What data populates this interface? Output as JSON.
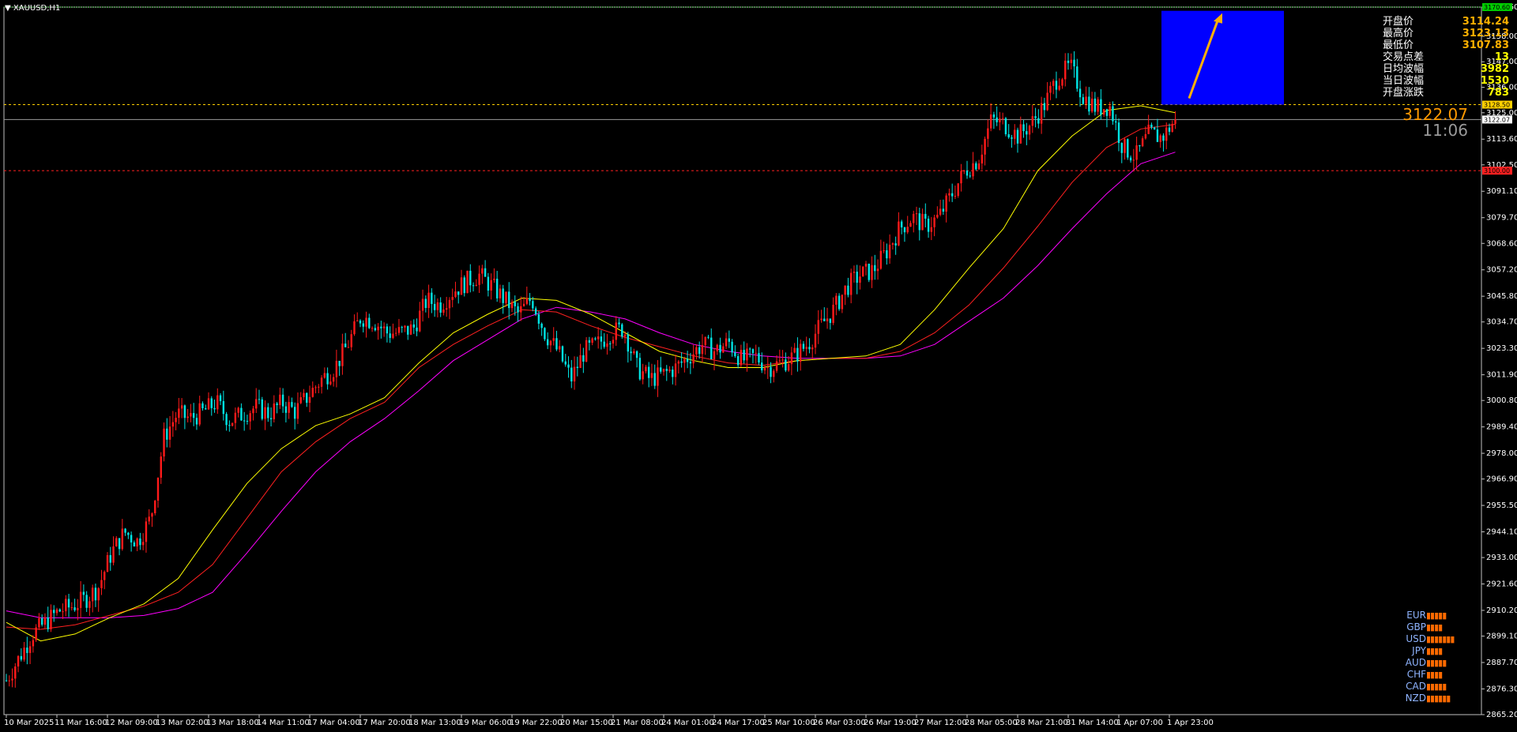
{
  "symbol": "XAUUSD,H1",
  "big_price": "3122.07",
  "countdown": "11:06",
  "stats": [
    {
      "label": "开盘价",
      "value": "3114.24"
    },
    {
      "label": "最高价",
      "value": "3123.13"
    },
    {
      "label": "最低价",
      "value": "3107.83"
    },
    {
      "label": "交易点差",
      "value": "13"
    },
    {
      "label": "日均波幅",
      "value": "3982"
    },
    {
      "label": "当日波幅",
      "value": "1530"
    },
    {
      "label": "开盘涨跌",
      "value": "783"
    }
  ],
  "currency_strength": [
    {
      "name": "EUR",
      "bars": "▮▮▮▮▮"
    },
    {
      "name": "GBP",
      "bars": "▮▮▮▮"
    },
    {
      "name": "USD",
      "bars": "▮▮▮▮▮▮▮"
    },
    {
      "name": "JPY",
      "bars": "▮▮▮▮"
    },
    {
      "name": "AUD",
      "bars": "▮▮▮▮▮"
    },
    {
      "name": "CHF",
      "bars": "▮▮▮▮"
    },
    {
      "name": "CAD",
      "bars": "▮▮▮▮▮"
    },
    {
      "name": "NZD",
      "bars": "▮▮▮▮▮▮"
    }
  ],
  "colors": {
    "background": "#000000",
    "bull": "#ff1a1a",
    "bear": "#00e5e5",
    "ma_fast": "#ffff00",
    "ma_mid": "#ff2020",
    "ma_slow": "#ff00ff",
    "target_box": "#0000ff",
    "arrow": "#ffb000"
  },
  "chart_data": {
    "type": "candlestick",
    "ylim": [
      2865.2,
      3170.6
    ],
    "y_ticks": [
      "3170.60",
      "3158.00",
      "3147.00",
      "3136.00",
      "3125.00",
      "3113.60",
      "3102.50",
      "3091.10",
      "3079.70",
      "3068.60",
      "3057.20",
      "3045.80",
      "3034.70",
      "3023.30",
      "3011.90",
      "3000.80",
      "2989.40",
      "2978.00",
      "2966.90",
      "2955.50",
      "2944.10",
      "2933.00",
      "2921.60",
      "2910.20",
      "2899.10",
      "2887.70",
      "2876.30",
      "2865.20"
    ],
    "x_labels": [
      "10 Mar 2025",
      "11 Mar 16:00",
      "12 Mar 09:00",
      "13 Mar 02:00",
      "13 Mar 18:00",
      "14 Mar 11:00",
      "17 Mar 04:00",
      "17 Mar 20:00",
      "18 Mar 13:00",
      "19 Mar 06:00",
      "19 Mar 22:00",
      "20 Mar 15:00",
      "21 Mar 08:00",
      "24 Mar 01:00",
      "24 Mar 17:00",
      "25 Mar 10:00",
      "26 Mar 03:00",
      "26 Mar 19:00",
      "27 Mar 12:00",
      "28 Mar 05:00",
      "28 Mar 21:00",
      "31 Mar 14:00",
      "1 Apr 07:00",
      "1 Apr 23:00"
    ],
    "bars_per_label": 17,
    "anchors": [
      2880,
      2890,
      2900,
      2905,
      2910,
      2912,
      2915,
      2920,
      2935,
      2944,
      2940,
      2950,
      2985,
      2995,
      2993,
      2996,
      3000,
      2992,
      2995,
      2998,
      2995,
      3000,
      2996,
      3003,
      3010,
      3015,
      3025,
      3037,
      3035,
      3030,
      3030,
      3032,
      3044,
      3042,
      3048,
      3052,
      3055,
      3050,
      3044,
      3038,
      3045,
      3030,
      3022,
      3010,
      3022,
      3025,
      3030,
      3032,
      3015,
      3010,
      3012,
      3015,
      3020,
      3025,
      3022,
      3026,
      3018,
      3020,
      3015,
      3017,
      3020,
      3025,
      3033,
      3040,
      3050,
      3055,
      3057,
      3065,
      3075,
      3080,
      3076,
      3080,
      3090,
      3100,
      3105,
      3122,
      3120,
      3115,
      3120,
      3128,
      3140,
      3145,
      3132,
      3127,
      3128,
      3110,
      3106,
      3116,
      3114.24,
      3122.07
    ],
    "ma_fast": [
      2905,
      2897,
      2900,
      2907,
      2913,
      2924,
      2945,
      2965,
      2980,
      2990,
      2995,
      3002,
      3017,
      3030,
      3038,
      3045,
      3044,
      3038,
      3030,
      3022,
      3018,
      3015,
      3015,
      3018,
      3019,
      3020,
      3025,
      3040,
      3058,
      3075,
      3100,
      3115,
      3126,
      3128,
      3125
    ],
    "ma_mid": [
      2903,
      2902,
      2904,
      2908,
      2912,
      2918,
      2930,
      2950,
      2970,
      2983,
      2993,
      3000,
      3015,
      3025,
      3033,
      3040,
      3039,
      3033,
      3028,
      3024,
      3020,
      3017,
      3016,
      3018,
      3019,
      3019,
      3022,
      3030,
      3042,
      3058,
      3076,
      3095,
      3110,
      3118,
      3120
    ],
    "ma_slow": [
      2910,
      2907,
      2907,
      2907,
      2908,
      2911,
      2918,
      2935,
      2953,
      2970,
      2983,
      2993,
      3005,
      3018,
      3027,
      3036,
      3041,
      3039,
      3036,
      3030,
      3025,
      3022,
      3020,
      3019,
      3019,
      3019,
      3020,
      3025,
      3035,
      3045,
      3059,
      3075,
      3090,
      3103,
      3108
    ],
    "levels": [
      {
        "label": "3170.60",
        "value": 3170.6,
        "color": "#00cc00",
        "style": "dotted"
      },
      {
        "label": "3128.50",
        "value": 3128.5,
        "color": "#ffd000",
        "style": "dashed"
      },
      {
        "label": "3122.07",
        "value": 3122.07,
        "color": "#9a9a9a",
        "style": "solid"
      },
      {
        "label": "3100.00",
        "value": 3100.0,
        "color": "#ff2020",
        "style": "dashed"
      }
    ],
    "last_price": 3122.07,
    "target_box": {
      "y_top": 3169,
      "y_bottom": 3128.5
    },
    "grid": false
  }
}
